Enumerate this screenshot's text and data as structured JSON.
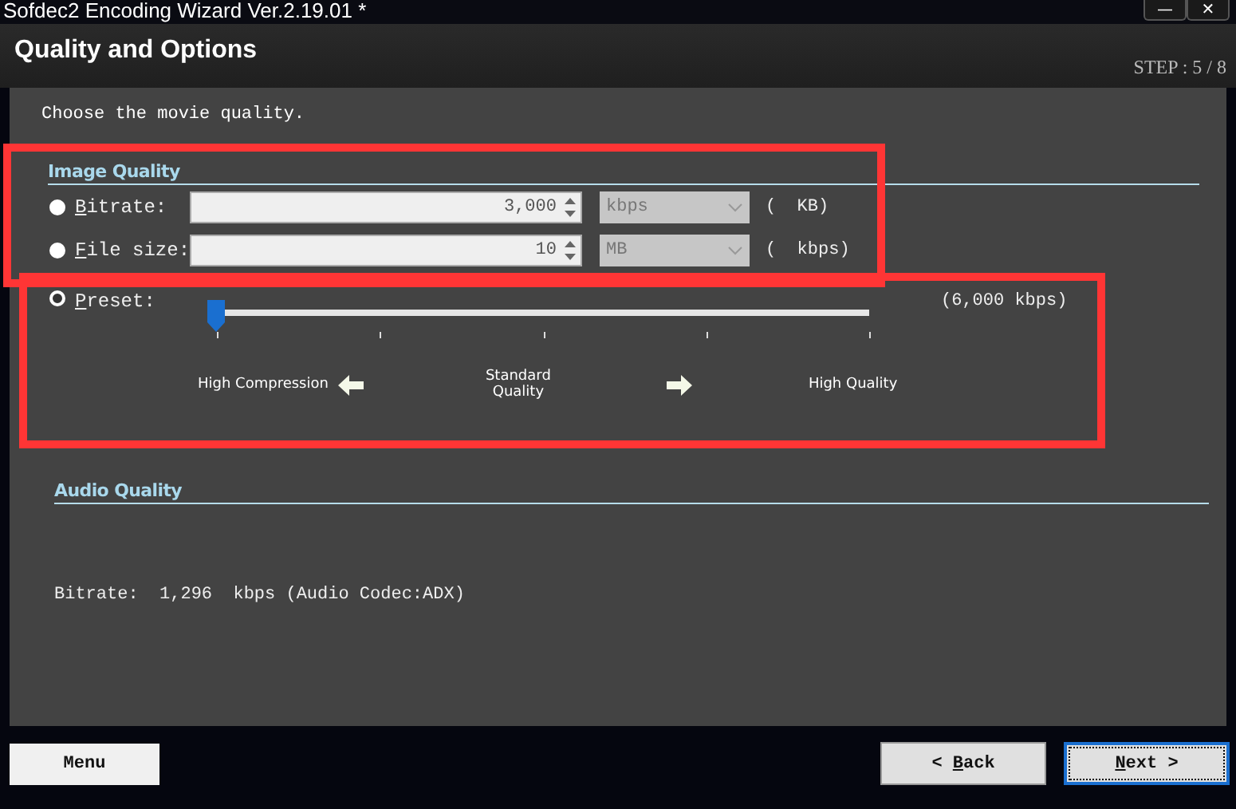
{
  "window": {
    "title": "Sofdec2 Encoding Wizard Ver.2.19.01 *",
    "controls": [
      "—",
      "✕"
    ]
  },
  "header": {
    "title": "Quality and Options",
    "step": "STEP : 5 / 8"
  },
  "instruction": "Choose the movie quality.",
  "image_quality": {
    "heading": "Image Quality",
    "options": [
      {
        "kind": "field",
        "label": "Bitrate:",
        "mnemonic": true,
        "selected": false,
        "value": "3,000",
        "unit": "kbps",
        "note": "(  KB)"
      },
      {
        "kind": "field",
        "label": "File size:",
        "mnemonic": true,
        "selected": false,
        "value": "10",
        "unit": "MB",
        "note": "(  kbps)"
      },
      {
        "kind": "slider",
        "label": "Preset:",
        "mnemonic": true,
        "selected": true,
        "level": 0,
        "reading": "(6,000 kbps)"
      }
    ],
    "scale": [
      {
        "kind": "text",
        "text": "High Compression"
      },
      {
        "kind": "left_arrow"
      },
      {
        "kind": "text",
        "text": "Standard Quality"
      },
      {
        "kind": "right_arrow"
      },
      {
        "kind": "text",
        "text": "High Quality"
      }
    ]
  },
  "audio_quality": {
    "heading": "Audio Quality",
    "info": "Bitrate:  1,296  kbps (Audio Codec:ADX)"
  },
  "buttons": [
    {
      "label": "Menu",
      "mnemonic": false,
      "focused": false
    },
    {
      "label": "< Back",
      "mnemonic": true,
      "focused": false
    },
    {
      "label": "Next >",
      "mnemonic": true,
      "focused": true
    }
  ]
}
